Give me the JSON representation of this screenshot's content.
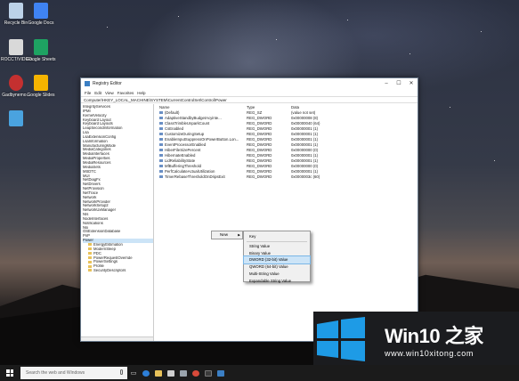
{
  "desktop": {
    "icons": [
      {
        "label": "Recycle Bin",
        "color": "#bcd2e8"
      },
      {
        "label": "Google Docs",
        "color": "#3f83f3"
      },
      {
        "label": "ROCCT/VIDEO...",
        "color": "#d9d9d9"
      },
      {
        "label": "Google Sheets",
        "color": "#1ea362"
      },
      {
        "label": "Gadbynemo...",
        "color": "#c43030"
      },
      {
        "label": "Google Slides",
        "color": "#f5b400"
      },
      {
        "label": "",
        "color": "#4aa3df"
      }
    ]
  },
  "window": {
    "title": "Registry Editor",
    "menu": [
      "File",
      "Edit",
      "View",
      "Favorites",
      "Help"
    ],
    "address": "Computer\\HKEY_LOCAL_MACHINE\\SYSTEM\\CurrentControlSet\\Control\\Power",
    "tree": [
      "IntegrityServices",
      "IPMI",
      "KernelVelocity",
      "Keyboard Layout",
      "Keyboard Layouts",
      "LeapSecondInformation",
      "Lsa",
      "LsaExtensionConfig",
      "LsaInformation",
      "ManufacturingMode",
      "MediaCategories",
      "MediaInterfaces",
      "MediaProperties",
      "MediaResources",
      "MediaSets",
      "MSDTC",
      "MUI",
      "NetDiagFx",
      "NetDrivers",
      "NetProvision",
      "NetTrace",
      "Network",
      "NetworkProvider",
      "NetworkSetup2",
      "NetworkUxManager",
      "NIs",
      "NodeInterfaces",
      "Notifications",
      "Nsi",
      "OSExtensionDatabase",
      "PnP",
      "Power"
    ],
    "tree_selected": "Power",
    "tree_sub": [
      "EnergyEstimation",
      "ModernSleep",
      "PDC",
      "PowerRequestOverride",
      "PowerSettings",
      "Profile",
      "SecurityDescriptors"
    ],
    "columns": {
      "name": "Name",
      "type": "Type",
      "data": "Data"
    },
    "values": [
      {
        "name": "(Default)",
        "type": "REG_SZ",
        "data": "(value not set)"
      },
      {
        "name": "AdaptiveStandbyBudgetAcyinte...",
        "type": "REG_DWORD",
        "data": "0x00000008 (8)"
      },
      {
        "name": "ClassTrimbleUnparkCount",
        "type": "REG_DWORD",
        "data": "0x00000040 (64)"
      },
      {
        "name": "CsEnabled",
        "type": "REG_DWORD",
        "data": "0x00000001 (1)"
      },
      {
        "name": "CustomizeDuringSetup",
        "type": "REG_DWORD",
        "data": "0x00000001 (1)"
      },
      {
        "name": "EnableInputSuppressOnPowerButton.Lon...",
        "type": "REG_DWORD",
        "data": "0x00000001 (1)"
      },
      {
        "name": "EventProcessorEnabled",
        "type": "REG_DWORD",
        "data": "0x00000001 (1)"
      },
      {
        "name": "HiberFileSizePercent",
        "type": "REG_DWORD",
        "data": "0x00000000 (0)"
      },
      {
        "name": "HibernateEnabled",
        "type": "REG_DWORD",
        "data": "0x00000001 (1)"
      },
      {
        "name": "LidReliabilityState",
        "type": "REG_DWORD",
        "data": "0x00000001 (1)"
      },
      {
        "name": "MfBufferingThreshold",
        "type": "REG_DWORD",
        "data": "0x00000000 (0)"
      },
      {
        "name": "PerfCalculateActualUtilization",
        "type": "REG_DWORD",
        "data": "0x00000001 (1)"
      },
      {
        "name": "TimerRebaseThresholdOnDripsExit",
        "type": "REG_DWORD",
        "data": "0x0000003c (60)"
      }
    ]
  },
  "context_menu": {
    "new_label": "New",
    "submenu": [
      "Key",
      "String Value",
      "Binary Value",
      "DWORD (32-bit) Value",
      "QWORD (64-bit) Value",
      "Multi-String Value",
      "Expandable String Value"
    ],
    "highlighted": "DWORD (32-bit) Value"
  },
  "taskbar": {
    "search_placeholder": "Search the web and Windows"
  },
  "watermark": {
    "title": "Win10 之家",
    "url": "www.win10xitong.com",
    "colors": {
      "logo": "#1e9be6"
    }
  }
}
